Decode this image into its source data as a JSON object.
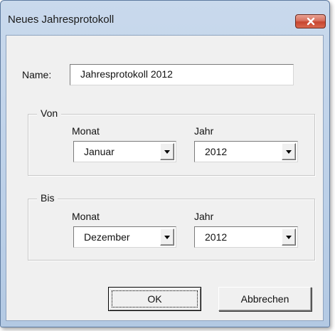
{
  "window": {
    "title": "Neues Jahresprotokoll",
    "close_label": "×"
  },
  "name_field": {
    "label": "Name:",
    "value": "Jahresprotokoll 2012"
  },
  "von": {
    "legend": "Von",
    "month_label": "Monat",
    "month_value": "Januar",
    "year_label": "Jahr",
    "year_value": "2012"
  },
  "bis": {
    "legend": "Bis",
    "month_label": "Monat",
    "month_value": "Dezember",
    "year_label": "Jahr",
    "year_value": "2012"
  },
  "buttons": {
    "ok": "OK",
    "cancel": "Abbrechen"
  },
  "colors": {
    "titlebar": "#bcd0e8",
    "close_button": "#c7452f",
    "client_background": "#f0f0f0"
  }
}
